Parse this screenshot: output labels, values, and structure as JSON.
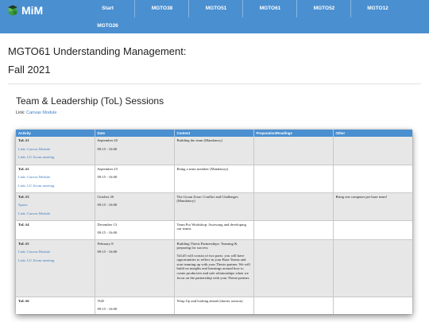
{
  "brand": {
    "name": "MiM",
    "logo_icon": "grad-cap-logo-icon"
  },
  "nav": {
    "items": [
      "Start",
      "MGTO38",
      "MGTO51",
      "MGTO61",
      "MGTO52",
      "MGTO12"
    ],
    "items_row2": [
      "MGTO26"
    ]
  },
  "page": {
    "title_line1": "MGTO61 Understanding Management:",
    "title_line2": "Fall 2021"
  },
  "section": {
    "title": "Team & Leadership (ToL) Sessions",
    "link_prefix": "Link:",
    "link_text": "Canvas Module"
  },
  "table": {
    "headers": [
      "Activity",
      "Date",
      "Content",
      "Preparation/Readings",
      "Other"
    ],
    "rows": [
      {
        "activity": "ToL #1",
        "act_links": [
          "Link: Canvas Module",
          "Link: LU Zoom meeting"
        ],
        "date": "September 20",
        "time": "09:15 - 16:00",
        "content": "Building the team (Mandatory)",
        "content2": "",
        "prep": "",
        "other": ""
      },
      {
        "activity": "ToL #2",
        "act_links": [
          "Link: Canvas Module",
          "Link: LU Zoom meeting"
        ],
        "date": "September 23",
        "time": "09:15 - 16:00",
        "content": "Being a team member (Mandatory)",
        "content2": "",
        "prep": "",
        "other": ""
      },
      {
        "activity": "ToL #3",
        "act_links": [
          "Sparis",
          "Link: Canvas Module"
        ],
        "date": "October 20",
        "time": "09:15 - 16:00",
        "content": "The Groan Zone: Conflict and Challenges (Mandatory)",
        "content2": "",
        "prep": "",
        "other": "Bring one computer per base team!"
      },
      {
        "activity": "ToL #4",
        "act_links": [],
        "date": "December 13",
        "time": "09:15 - 16:00",
        "content": "Team Pro Workshop: Assessing and developing our teams",
        "content2": "",
        "prep": "",
        "other": ""
      },
      {
        "activity": "ToL #5",
        "act_links": [
          "Link: Canvas Module",
          "Link: LU Zoom meeting"
        ],
        "date": "February 8",
        "time": "09:15 - 16:00",
        "content": "Building Thesis Partnerships: Teaming & preparing for success",
        "content2": "ToL#5 will consist of two parts: you will have opportunities to reflect in your Base Teams and start teaming up with your Thesis-partner. We will build on insights and learnings around how to create productive and safe relationships when we focus on the partnership with your Thesis-partner.",
        "prep": "",
        "other": ""
      },
      {
        "activity": "ToL #6",
        "act_links": [],
        "date": "TbD",
        "time": "09:15 - 16:00",
        "content": "Wrap Up and looking ahead (shorter session)",
        "content2": "",
        "prep": "",
        "other": ""
      }
    ]
  },
  "colors": {
    "nav_bg": "#4a8fd0",
    "link": "#3b7dc4",
    "row_gray": "#e7e7e7"
  }
}
